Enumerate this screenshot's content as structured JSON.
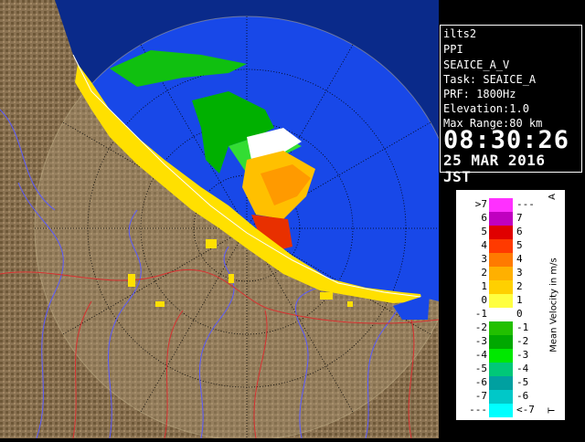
{
  "info": {
    "station": "ilts2",
    "product": "PPI",
    "field": "SEAICE_A_V",
    "task": "Task: SEAICE_A",
    "prf": "PRF: 1800Hz",
    "elevation": "Elevation:1.0",
    "max_range": "Max Range:80 km",
    "time": "08:30:26",
    "date": "25 MAR 2016 JST"
  },
  "legend": {
    "title": "Mean Velocity in m/s",
    "top_mark": "A",
    "bottom_mark": "T",
    "rows": [
      {
        "left": ">7",
        "right": "---",
        "color": "#ff30ff"
      },
      {
        "left": "6",
        "right": "7",
        "color": "#c000c0"
      },
      {
        "left": "5",
        "right": "6",
        "color": "#e00000"
      },
      {
        "left": "4",
        "right": "5",
        "color": "#ff3a00"
      },
      {
        "left": "3",
        "right": "4",
        "color": "#ff7a00"
      },
      {
        "left": "2",
        "right": "3",
        "color": "#ffb000"
      },
      {
        "left": "1",
        "right": "2",
        "color": "#ffd000"
      },
      {
        "left": "0",
        "right": "1",
        "color": "#ffff40"
      },
      {
        "left": "-1",
        "right": "0",
        "color": "#ffffff"
      },
      {
        "left": "-2",
        "right": "-1",
        "color": "#22c000"
      },
      {
        "left": "-3",
        "right": "-2",
        "color": "#00a800"
      },
      {
        "left": "-4",
        "right": "-3",
        "color": "#00e800"
      },
      {
        "left": "-5",
        "right": "-4",
        "color": "#00c878"
      },
      {
        "left": "-6",
        "right": "-5",
        "color": "#00a0a0"
      },
      {
        "left": "-7",
        "right": "-6",
        "color": "#00c8c8"
      },
      {
        "left": "---",
        "right": "<-7",
        "color": "#00ffff"
      }
    ]
  },
  "colors": {
    "sea": "#1040e0",
    "outer_blue": "#0a2a8a",
    "land": "#8a7050",
    "coast": "#ffe000",
    "rivers": "#6060ff",
    "roads": "#d03030"
  }
}
